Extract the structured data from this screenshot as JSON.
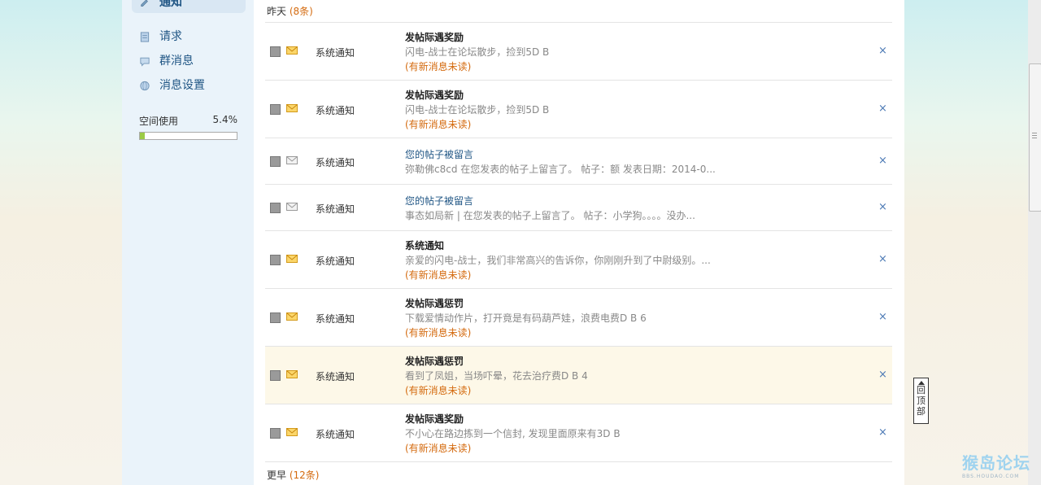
{
  "sidebar": {
    "items": [
      {
        "label": "通知",
        "icon": "pencil-icon"
      },
      {
        "label": "请求",
        "icon": "document-icon"
      },
      {
        "label": "群消息",
        "icon": "chat-bubble-icon"
      },
      {
        "label": "消息设置",
        "icon": "globe-icon"
      }
    ]
  },
  "space": {
    "label": "空间使用",
    "value": "5.4%",
    "fraction": 0.054
  },
  "yesterday": {
    "label": "昨天",
    "count": "(8条)"
  },
  "earlier": {
    "label": "更早",
    "count": "(12条)"
  },
  "rows": [
    {
      "source": "系统通知",
      "title": "发帖际遇奖励",
      "title_link": false,
      "desc": "闪电-战士在论坛散步，捡到5D B",
      "new": "(有新消息未读)",
      "read": false
    },
    {
      "source": "系统通知",
      "title": "发帖际遇奖励",
      "title_link": false,
      "desc": "闪电-战士在论坛散步，捡到5D B",
      "new": "(有新消息未读)",
      "read": false
    },
    {
      "source": "系统通知",
      "title": "您的帖子被留言",
      "title_link": true,
      "desc": "弥勒佛c8cd 在您发表的帖子上留言了。 帖子：额 发表日期：2014-0...",
      "new": "",
      "read": true
    },
    {
      "source": "系统通知",
      "title": "您的帖子被留言",
      "title_link": true,
      "desc": "事态如局新 | 在您发表的帖子上留言了。 帖子：小学狗。。。。没办...",
      "new": "",
      "read": true
    },
    {
      "source": "系统通知",
      "title": "系统通知",
      "title_link": false,
      "desc": "亲爱的闪电-战士，我们非常高兴的告诉你，你刚刚升到了中尉级别。...",
      "new": "(有新消息未读)",
      "read": false
    },
    {
      "source": "系统通知",
      "title": "发帖际遇惩罚",
      "title_link": false,
      "desc": "下载爱情动作片，打开竟是有码葫芦娃，浪费电费D B 6",
      "new": "(有新消息未读)",
      "read": false
    },
    {
      "source": "系统通知",
      "title": "发帖际遇惩罚",
      "title_link": false,
      "desc": "看到了凤姐，当场吓晕，花去治疗费D B 4",
      "new": "(有新消息未读)",
      "read": false
    },
    {
      "source": "系统通知",
      "title": "发帖际遇奖励",
      "title_link": false,
      "desc": "不小心在路边拣到一个信封, 发现里面原来有3D B",
      "new": "(有新消息未读)",
      "read": false
    }
  ],
  "close_glyph": "×",
  "back_top": {
    "label": "回顶部"
  },
  "logo": {
    "text": "猴岛论坛",
    "sub": "BBS.HOUDAO.COM"
  },
  "colors": {
    "accent": "#d46a0e",
    "link": "#1f5584",
    "close": "#4a78b4",
    "highlight_bg": "#fdf8e8"
  }
}
